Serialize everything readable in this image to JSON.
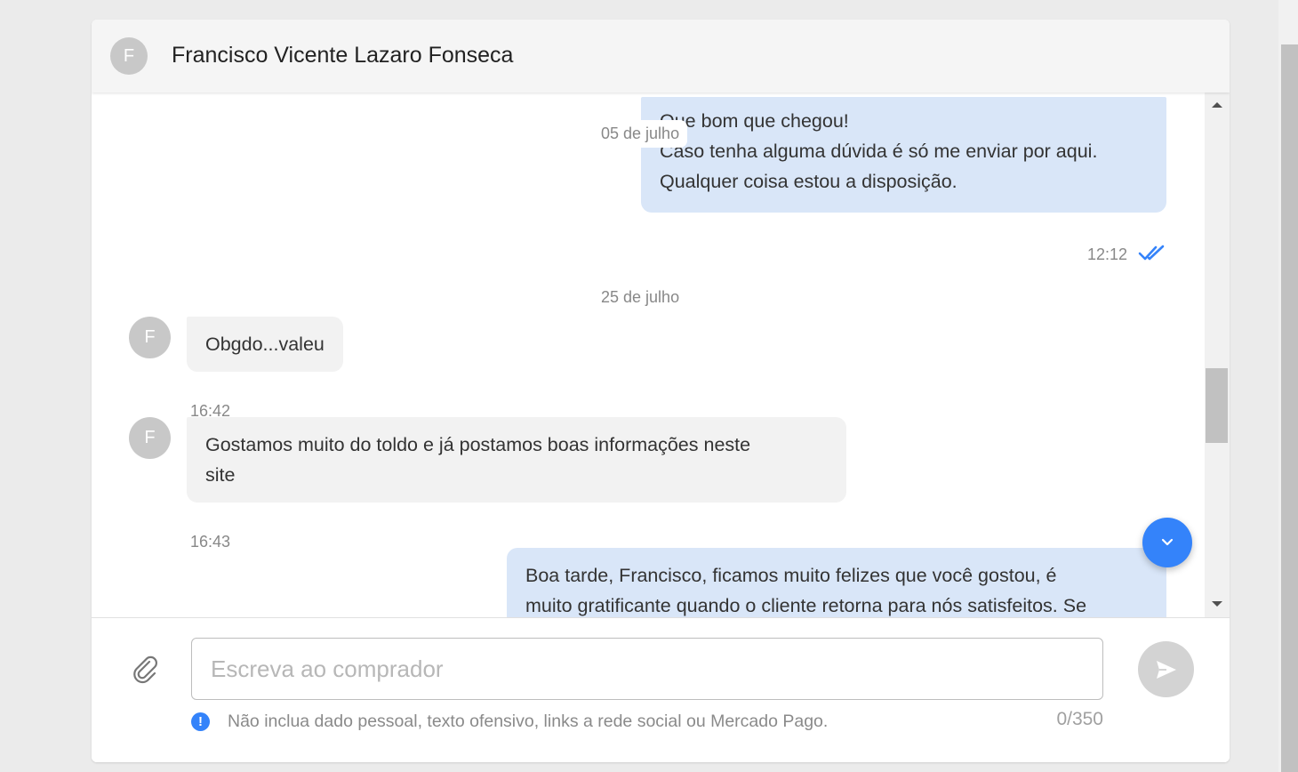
{
  "conversation": {
    "contact_initial": "F",
    "contact_name": "Francisco Vicente Lazaro Fonseca"
  },
  "messages": {
    "m1": {
      "lines": [
        "Que bom que chegou!",
        "Caso tenha alguma dúvida é só me enviar por aqui.",
        "Qualquer coisa estou a disposição."
      ],
      "time": "12:12",
      "status": "read"
    },
    "floating_date": "05 de julho",
    "date_separator": "25 de julho",
    "m2": {
      "text": "Obgdo...valeu",
      "time": "16:42"
    },
    "m3": {
      "lines": [
        "Gostamos muito do toldo e já postamos boas informações neste",
        "site"
      ],
      "time": "16:43"
    },
    "m4": {
      "lines": [
        "Boa tarde, Francisco, ficamos muito felizes que você gostou, é",
        "muito gratificante quando o cliente retorna para nós satisfeitos. Se"
      ]
    }
  },
  "composer": {
    "placeholder": "Escreva ao comprador",
    "value": "",
    "warning": "Não inclua dado pessoal, texto ofensivo, links a rede social ou Mercado Pago.",
    "counter": "0/350"
  },
  "colors": {
    "accent": "#3483fa",
    "outgoing_bubble": "#d9e6f8",
    "incoming_bubble": "#f2f2f2",
    "header_bg": "#f5f5f5"
  },
  "icons": {
    "attach": "paperclip-icon",
    "send": "send-icon",
    "scroll_down": "chevron-down-icon",
    "read_receipt": "double-check-icon",
    "warning": "exclamation-circle-icon"
  }
}
